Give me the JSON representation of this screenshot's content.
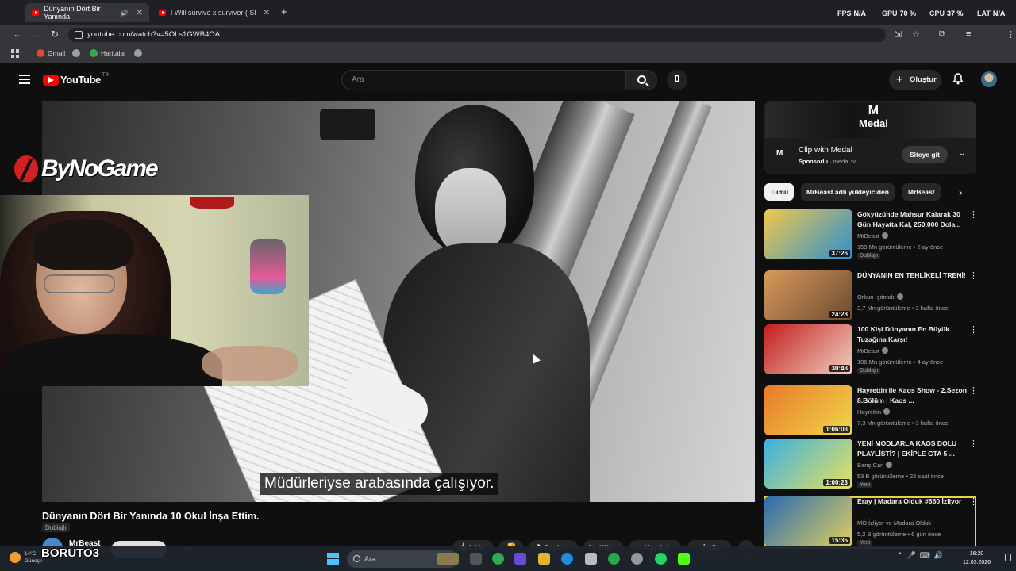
{
  "browser": {
    "tabs": [
      {
        "title": "Dünyanın Dört Bir Yanında"
      },
      {
        "title": "I Will survive x survivor ( SLOW..."
      }
    ],
    "close_glyph": "✕",
    "new_tab_glyph": "+",
    "perf": {
      "fps_label": "FPS",
      "fps_value": "N/A",
      "gpu_label": "GPU",
      "gpu_value": "70 %",
      "cpu_label": "CPU",
      "cpu_value": "37 %",
      "lat_label": "LAT",
      "lat_value": "N/A"
    },
    "url": "youtube.com/watch?v=5OLs1GWB4OA",
    "bookmarks": [
      {
        "label": "Gmail",
        "color": "#ea4335"
      },
      {
        "label": "",
        "color": "#9aa0a6"
      },
      {
        "label": "Haritalar",
        "color": "#34a853"
      },
      {
        "label": "",
        "color": "#9aa0a6"
      }
    ]
  },
  "youtube": {
    "logo_text": "YouTube",
    "region": "TR",
    "search_placeholder": "Ara",
    "create_label": "Oluştur"
  },
  "overlay": {
    "brand": "ByNoGame",
    "username": "BORUTO3"
  },
  "video": {
    "subtitle": "Müdürleriyse arabasında çalışıyor.",
    "title": "Dünyanın Dört Bir Yanında 10 Okul İnşa Ettim.",
    "dub_badge": "Dublajlı",
    "channel": "MrBeast",
    "actions": {
      "likes": "2 Mn",
      "share": "Paylaş",
      "clip": "Klip",
      "save": "Kaydet",
      "download": "İndir"
    }
  },
  "ad": {
    "brand": "Medal",
    "title": "Clip with Medal",
    "sponsored": "Sponsorlu",
    "domain": "medal.tv",
    "cta": "Siteye git"
  },
  "chips": [
    "Tümü",
    "MrBeast adlı yükleyiciden",
    "MrBeast"
  ],
  "recommendations": [
    {
      "title": "Gökyüzünde Mahsur Kalarak 30 Gün Hayatta Kal, 250.000 Dola...",
      "channel": "MrBeast",
      "verified": true,
      "meta": "159 Mn görüntüleme • 2 ay önce",
      "badge": "Dublajlı",
      "duration": "37:26",
      "thumb_colors": [
        "#f0c84a",
        "#2e8fd0"
      ]
    },
    {
      "title": "DÜNYANIN EN TEHLİKELİ TRENİ!",
      "channel": "Orkun Işıtmak",
      "verified": true,
      "meta": "3,7 Mn görüntüleme • 3 hafta önce",
      "badge": "",
      "duration": "24:28",
      "thumb_colors": [
        "#d89a5a",
        "#6a4a30"
      ]
    },
    {
      "title": "100 Kişi Dünyanın En Büyük Tuzağına Karşı!",
      "channel": "MrBeast",
      "verified": true,
      "meta": "106 Mn görüntüleme • 4 ay önce",
      "badge": "Dublajlı",
      "duration": "30:43",
      "thumb_colors": [
        "#c41e1e",
        "#f0d0c0"
      ]
    },
    {
      "title": "Hayrettin ile Kaos Show - 2.Sezon 8.Bölüm | Kaos ...",
      "channel": "Hayrettin",
      "verified": true,
      "meta": "7,3 Mn görüntüleme • 3 hafta önce",
      "badge": "",
      "duration": "1:06:03",
      "thumb_colors": [
        "#e87a2a",
        "#f0d84a"
      ]
    },
    {
      "title": "YENİ MODLARLA KAOS DOLU PLAYLİSTİ? | EKİPLE GTA 5 ...",
      "channel": "Barış Can",
      "verified": true,
      "meta": "53 B görüntüleme • 22 saat önce",
      "badge": "Yeni",
      "duration": "1:00:23",
      "thumb_colors": [
        "#3ab0e0",
        "#e8e060"
      ]
    },
    {
      "title": "Eray | Madara Olduk #660 İzliyor",
      "channel": "MO İzliyor ve Madara Olduk",
      "verified": false,
      "meta": "5,2 B görüntüleme • 6 gün önce",
      "badge": "Yeni",
      "duration": "15:35",
      "thumb_colors": [
        "#2a6ab0",
        "#e0d060"
      ]
    }
  ],
  "taskbar": {
    "weather_temp": "14°C",
    "weather_desc": "Güneşli",
    "search_placeholder": "Ara",
    "time": "16:20",
    "date": "12.03.2026"
  }
}
